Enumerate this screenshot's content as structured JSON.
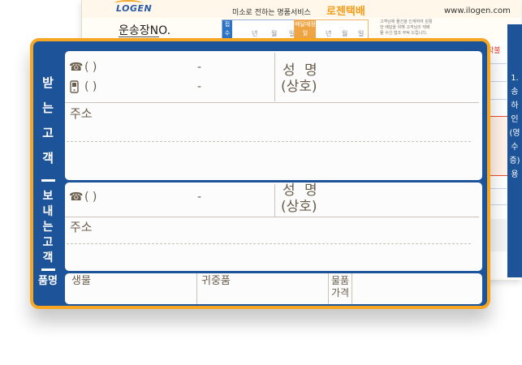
{
  "back": {
    "logo": "LOGEN",
    "slogan": "미소로 전하는 명품서비스",
    "brand": "로젠택배",
    "url": "www.ilogen.com",
    "waybill_label": "운송장NO.",
    "receipt_tag": "접수",
    "delivery_tag": "배달예정일",
    "date_units": [
      "년",
      "월",
      "일"
    ],
    "note": "고객님께 물건을 인계하여 원활한 배달을 위해 고객님의 택배물 수신 협조 부탁 드립니다.",
    "side_text": "1. 송 하 인 (영수증) 용",
    "side_label": "착불"
  },
  "receiver": {
    "section_label": "받는고객",
    "phone_line": "(          )",
    "mobile_line": "(          )",
    "dash": "-",
    "name_label": "성 명",
    "company_label": "(상호)",
    "address_label": "주소"
  },
  "sender": {
    "section_label": "보내는고객",
    "phone_line": "(          )",
    "dash": "-",
    "name_label": "성 명",
    "company_label": "(상호)",
    "address_label": "주소"
  },
  "item": {
    "section_label": "품명",
    "perishable": "생물",
    "valuables": "귀중품",
    "item_price": "물품\n가격"
  },
  "colors": {
    "card_blue": "#1c5399",
    "card_border": "#f7a621",
    "text_brown": "#6a5c4a"
  },
  "icons": {
    "phone": "telephone-icon",
    "mobile": "mobile-phone-icon"
  }
}
